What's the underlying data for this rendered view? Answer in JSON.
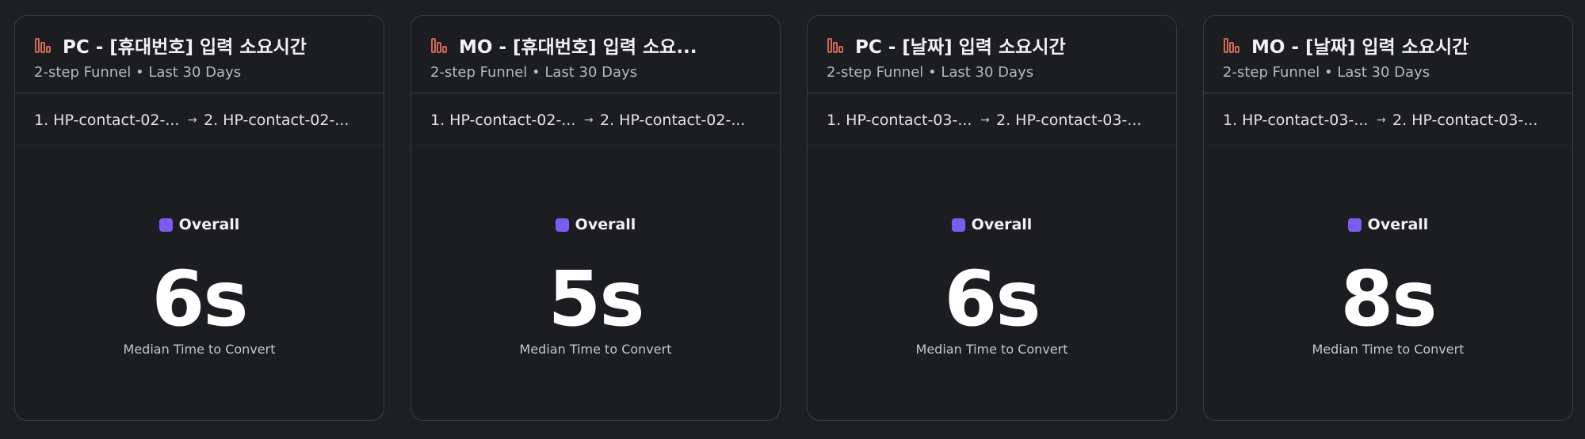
{
  "colors": {
    "background": "#1e1f23",
    "card": "#1c1d21",
    "icon": "#e8705a",
    "legend": "#7b5cf0"
  },
  "cards": [
    {
      "title": "PC - [휴대번호] 입력 소요시간",
      "subtitle": "2-step Funnel • Last 30 Days",
      "step1": "1. HP-contact-02-...",
      "step2": "2. HP-contact-02-...",
      "arrow": "→",
      "legend": "Overall",
      "value": "6s",
      "value_label": "Median Time to Convert"
    },
    {
      "title": "MO - [휴대번호] 입력 소요...",
      "subtitle": "2-step Funnel • Last 30 Days",
      "step1": "1. HP-contact-02-...",
      "step2": "2. HP-contact-02-...",
      "arrow": "→",
      "legend": "Overall",
      "value": "5s",
      "value_label": "Median Time to Convert"
    },
    {
      "title": "PC - [날짜] 입력 소요시간",
      "subtitle": "2-step Funnel • Last 30 Days",
      "step1": "1. HP-contact-03-...",
      "step2": "2. HP-contact-03-...",
      "arrow": "→",
      "legend": "Overall",
      "value": "6s",
      "value_label": "Median Time to Convert"
    },
    {
      "title": "MO - [날짜] 입력 소요시간",
      "subtitle": "2-step Funnel • Last 30 Days",
      "step1": "1. HP-contact-03-...",
      "step2": "2. HP-contact-03-...",
      "arrow": "→",
      "legend": "Overall",
      "value": "8s",
      "value_label": "Median Time to Convert"
    }
  ]
}
